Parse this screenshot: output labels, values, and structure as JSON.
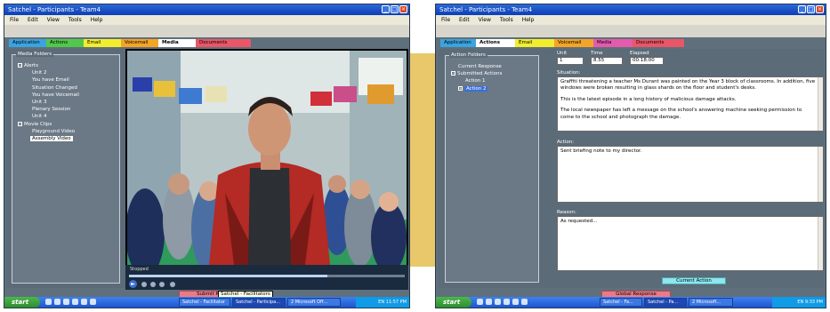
{
  "left": {
    "title": "Satchel - Participants - Team4",
    "menu": [
      "File",
      "Edit",
      "View",
      "Tools",
      "Help"
    ],
    "tabs": [
      {
        "label": "Application",
        "color": "#3aa4e0"
      },
      {
        "label": "Actions",
        "color": "#52c84a"
      },
      {
        "label": "Email",
        "color": "#f2ee2e"
      },
      {
        "label": "Voicemail",
        "color": "#f6a426"
      },
      {
        "label": "Media",
        "color": "#ffffff"
      },
      {
        "label": "Documents",
        "color": "#ea5666"
      }
    ],
    "folder_panel": {
      "caption": "Media Folders",
      "alerts_label": "Alerts",
      "alerts_items": [
        "Unit 2",
        "You have Email",
        "Situation Changed",
        "You have Voicemail",
        "Unit 3",
        "Plenary Session",
        "Unit 4"
      ],
      "clips_label": "Movie Clips",
      "clips_items": [
        "Playground Video",
        "Assembly Video"
      ],
      "selected": "Assembly Video"
    },
    "player": {
      "status": "Stopped",
      "progress": 0.72
    },
    "bottom_button": "Submit Response",
    "tooltip": "Satchel - Facilitators",
    "taskbar": {
      "start": "start",
      "tasks": [
        "Satchel - Facilitator",
        "Satchel - Participa...",
        "2 Microsoft Off..."
      ],
      "clock": "EN 11:57 PM"
    }
  },
  "right": {
    "title": "Satchel - Participants - Team4",
    "menu": [
      "File",
      "Edit",
      "View",
      "Tools",
      "Help"
    ],
    "tabs": [
      {
        "label": "Application",
        "color": "#3aa4e0"
      },
      {
        "label": "Actions",
        "color": "#ffffff"
      },
      {
        "label": "Email",
        "color": "#f2ee2e"
      },
      {
        "label": "Voicemail",
        "color": "#f6a426"
      },
      {
        "label": "Media",
        "color": "#e55aac"
      },
      {
        "label": "Documents",
        "color": "#ea5666"
      }
    ],
    "action_folders": {
      "caption": "Action Folders",
      "current_response": "Current Response",
      "submitted_label": "Submitted Actions",
      "items": [
        "Action 1",
        "Action 2"
      ],
      "selected": "Action 2"
    },
    "fields": {
      "unit_label": "Unit",
      "unit_value": "1",
      "time_label": "Time",
      "time_value": "8.55",
      "elapsed_label": "Elapsed",
      "elapsed_value": "00:18:00"
    },
    "situation": {
      "label": "Situation:",
      "paragraphs": [
        "Graffiti threatening a teacher Ms Durant was painted on the Year 3 block of classrooms. In addition, five windows were broken resulting in glass shards on the floor and student's desks.",
        "This is the latest episode in a long history of malicious damage attacks.",
        "The local newspaper has left a message on the school's answering machine seeking permission to come to the school and photograph the damage."
      ]
    },
    "action": {
      "label": "Action:",
      "value": "Sent briefing note to my director."
    },
    "reason": {
      "label": "Reason:",
      "value": "As requested..."
    },
    "current_action_button": "Current Action",
    "global_button": "Global Response",
    "taskbar": {
      "start": "start",
      "tasks": [
        "Satchel - Fa...",
        "Satchel - Pa...",
        "2 Microsoft..."
      ],
      "clock": "EN 9:33 PM"
    }
  }
}
